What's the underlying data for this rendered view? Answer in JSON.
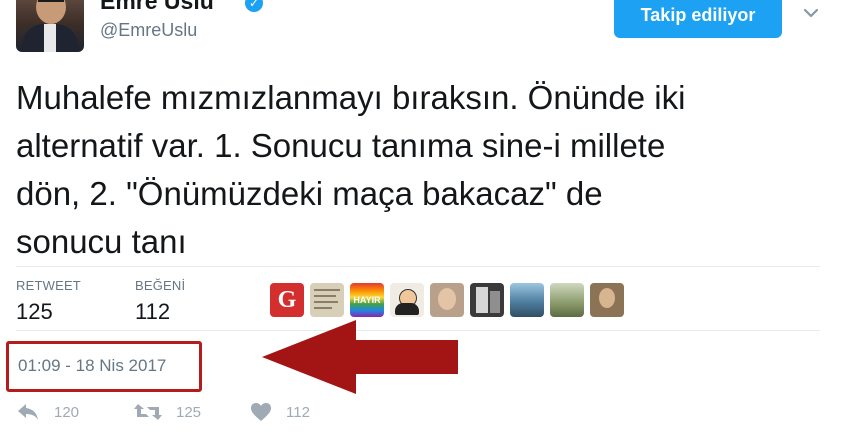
{
  "header": {
    "display_name": "Emre Uslu",
    "handle": "@EmreUslu",
    "follow_label": "Takip ediliyor"
  },
  "tweet": {
    "text": "Muhalefe mızmızlanmayı bıraksın. Önünde iki\nalternatif var. 1. Sonucu tanıma sine-i millete\ndön, 2. \"Önümüzdeki maça bakacaz\" de\nsonucu tanı"
  },
  "stats": {
    "retweet_label": "RETWEET",
    "retweet_count": "125",
    "like_label": "BEĞENİ",
    "like_count": "112"
  },
  "likers": [
    {
      "name": "liker-g-logo-avatar",
      "text": "G",
      "color": "#d32f2f"
    },
    {
      "name": "liker-document-avatar",
      "color": "#d8cfb8"
    },
    {
      "name": "liker-hayir-avatar",
      "text": "HAYIR"
    },
    {
      "name": "liker-popeye-avatar",
      "color": "#f0ece4"
    },
    {
      "name": "liker-face-avatar",
      "color": "#b9a08a"
    },
    {
      "name": "liker-bw-photo-avatar",
      "color": "#3a3a3a"
    },
    {
      "name": "liker-landscape-avatar",
      "color": "#4f7fa0"
    },
    {
      "name": "liker-field-avatar",
      "color": "#8a9a6a"
    },
    {
      "name": "liker-portrait-avatar",
      "color": "#8c7355"
    }
  ],
  "timestamp": "01:09 - 18 Nis 2017",
  "actions": {
    "reply_count": "120",
    "retweet_count": "125",
    "like_count": "112"
  },
  "colors": {
    "accent": "#1da1f2",
    "highlight": "#b71c1c"
  }
}
